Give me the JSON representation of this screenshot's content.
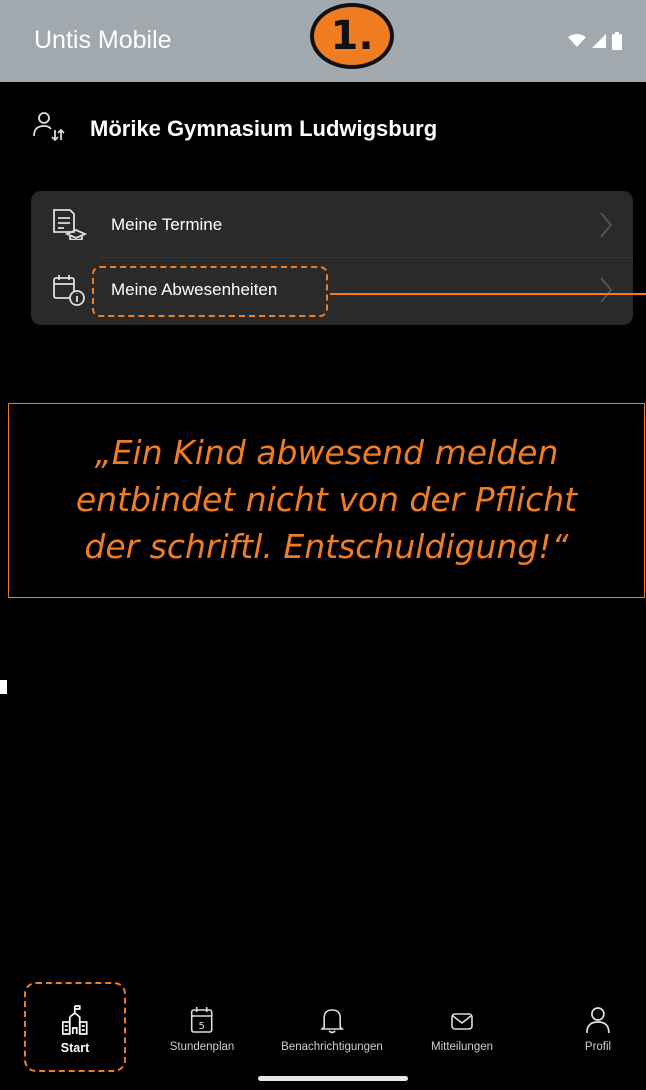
{
  "app": {
    "title": "Untis Mobile"
  },
  "step_badge": "1.",
  "school": {
    "name": "Mörike Gymnasium Ludwigsburg",
    "icon": "switch-user-icon"
  },
  "menu": {
    "items": [
      {
        "label": "Meine Termine",
        "icon": "calendar-document-icon"
      },
      {
        "label": "Meine Abwesenheiten",
        "icon": "calendar-info-icon"
      }
    ]
  },
  "note": {
    "text": "„Ein Kind abwesend melden\nentbindet nicht von der Pflicht\nder schriftl. Entschuldigung!“"
  },
  "nav": {
    "items": [
      {
        "label": "Start",
        "icon": "school-icon",
        "active": true
      },
      {
        "label": "Stundenplan",
        "icon": "calendar-icon",
        "badge": "5"
      },
      {
        "label": "Benachrichtigungen",
        "icon": "bell-icon"
      },
      {
        "label": "Mitteilungen",
        "icon": "mail-icon"
      },
      {
        "label": "Profil",
        "icon": "person-icon"
      }
    ]
  },
  "colors": {
    "accent": "#f07d22",
    "statusbar": "#a2a9ae",
    "card": "#2a2a2a"
  }
}
